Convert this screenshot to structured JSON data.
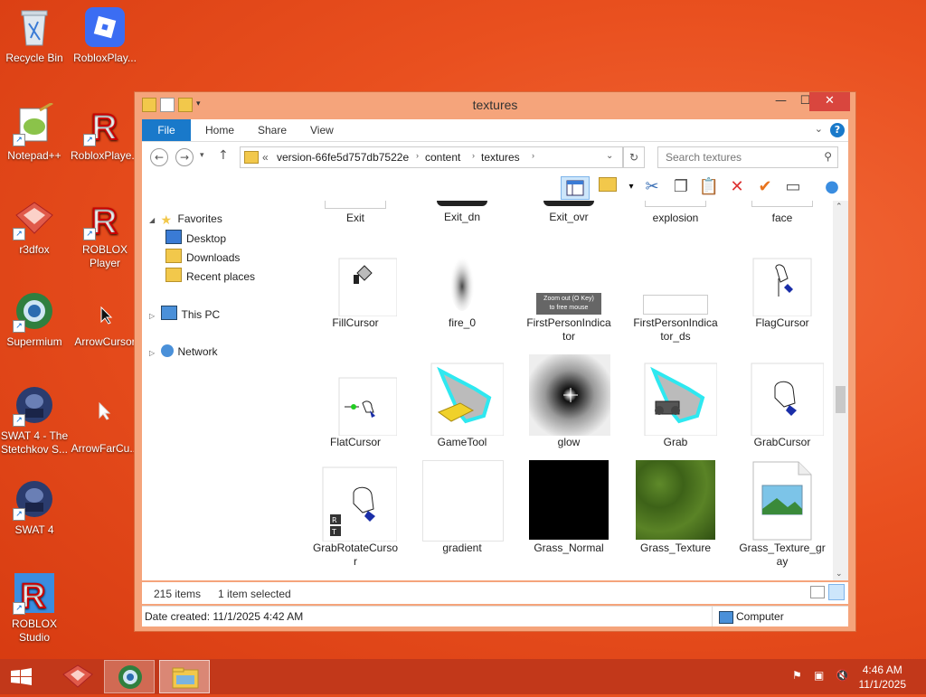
{
  "desktop": {
    "icons": [
      {
        "label": "Recycle Bin"
      },
      {
        "label": "RobloxPlay..."
      },
      {
        "label": "Notepad++"
      },
      {
        "label": "RobloxPlaye..."
      },
      {
        "label": "r3dfox"
      },
      {
        "label": "ROBLOX\nPlayer"
      },
      {
        "label": "Supermium"
      },
      {
        "label": "ArrowCursor"
      },
      {
        "label": "SWAT 4 - The\nStetchkov S..."
      },
      {
        "label": "ArrowFarCu..."
      },
      {
        "label": "SWAT 4"
      },
      {
        "label": "ROBLOX\nStudio"
      }
    ]
  },
  "window": {
    "title": "textures",
    "tabs": [
      "File",
      "Home",
      "Share",
      "View"
    ],
    "address": {
      "prefix": "«",
      "crumbs": [
        "version-66fe5d757db7522e",
        "content",
        "textures"
      ]
    },
    "search_placeholder": "Search textures",
    "nav": {
      "favorites": "Favorites",
      "desktop": "Desktop",
      "downloads": "Downloads",
      "recent": "Recent places",
      "thispc": "This PC",
      "network": "Network"
    },
    "files": [
      {
        "name": "Exit"
      },
      {
        "name": "Exit_dn"
      },
      {
        "name": "Exit_ovr"
      },
      {
        "name": "explosion"
      },
      {
        "name": "face"
      },
      {
        "name": "FillCursor"
      },
      {
        "name": "fire_0"
      },
      {
        "name": "FirstPersonIndica\ntor"
      },
      {
        "name": "FirstPersonIndica\ntor_ds"
      },
      {
        "name": "FlagCursor"
      },
      {
        "name": "FlatCursor"
      },
      {
        "name": "GameTool"
      },
      {
        "name": "glow"
      },
      {
        "name": "Grab"
      },
      {
        "name": "GrabCursor"
      },
      {
        "name": "GrabRotateCurso\nr"
      },
      {
        "name": "gradient"
      },
      {
        "name": "Grass_Normal"
      },
      {
        "name": "Grass_Texture"
      },
      {
        "name": "Grass_Texture_gr\nay"
      }
    ],
    "zoom_thumb_text": "Zoom out (O Key)\nto free mouse",
    "status": {
      "items": "215 items",
      "selected": "1 item selected"
    },
    "details": {
      "date": "Date created: 11/1/2025 4:42 AM",
      "location": "Computer"
    }
  },
  "taskbar": {
    "time": "4:46 AM",
    "date": "11/1/2025"
  }
}
